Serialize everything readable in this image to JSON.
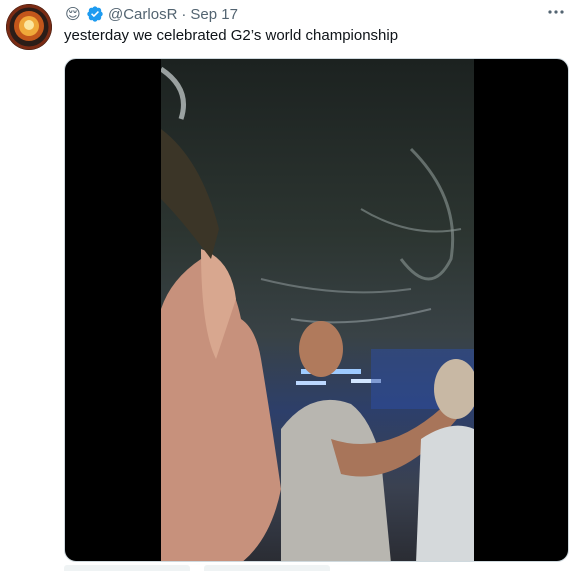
{
  "tweet": {
    "emoji": "😌",
    "handle": "@CarlosR",
    "separator": "·",
    "date": "Sep 17",
    "text": "yesterday we celebrated G2’s world championship",
    "more_icon": "ellipsis-icon",
    "verified_icon": "verified-badge-icon",
    "verified_color": "#1d9bf0"
  },
  "media": {
    "type": "video"
  }
}
